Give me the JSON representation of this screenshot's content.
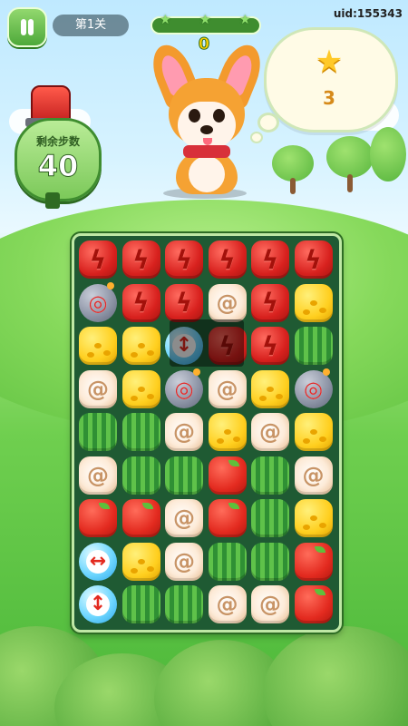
{
  "hud": {
    "level_label": "第1关",
    "score": "0",
    "uid": "uid:155343",
    "progress_fraction": 0.0
  },
  "moves": {
    "label": "剩余步数",
    "value": "40"
  },
  "target": {
    "icon": "star-icon",
    "count": "3"
  },
  "board": {
    "rows": 9,
    "cols": 6,
    "legend": {
      "R": "red-lightning-candy",
      "C": "cheese-candy",
      "W": "watermelon-candy",
      "S": "swirl-roll-candy",
      "A": "apple-candy",
      "B": "bomb-blocker",
      "V": "vertical-arrow-booster",
      "H": "horizontal-arrow-booster"
    },
    "grid": [
      [
        "R",
        "R",
        "R",
        "R",
        "R",
        "R"
      ],
      [
        "B",
        "R",
        "R",
        "S",
        "R",
        "C"
      ],
      [
        "C",
        "C",
        "V",
        "R",
        "R",
        "W"
      ],
      [
        "S",
        "C",
        "B",
        "S",
        "C",
        "B"
      ],
      [
        "W",
        "W",
        "S",
        "C",
        "S",
        "C"
      ],
      [
        "S",
        "W",
        "W",
        "A",
        "W",
        "S"
      ],
      [
        "A",
        "A",
        "S",
        "A",
        "W",
        "C"
      ],
      [
        "H",
        "C",
        "S",
        "W",
        "W",
        "A"
      ],
      [
        "V",
        "W",
        "W",
        "S",
        "S",
        "A"
      ]
    ]
  }
}
